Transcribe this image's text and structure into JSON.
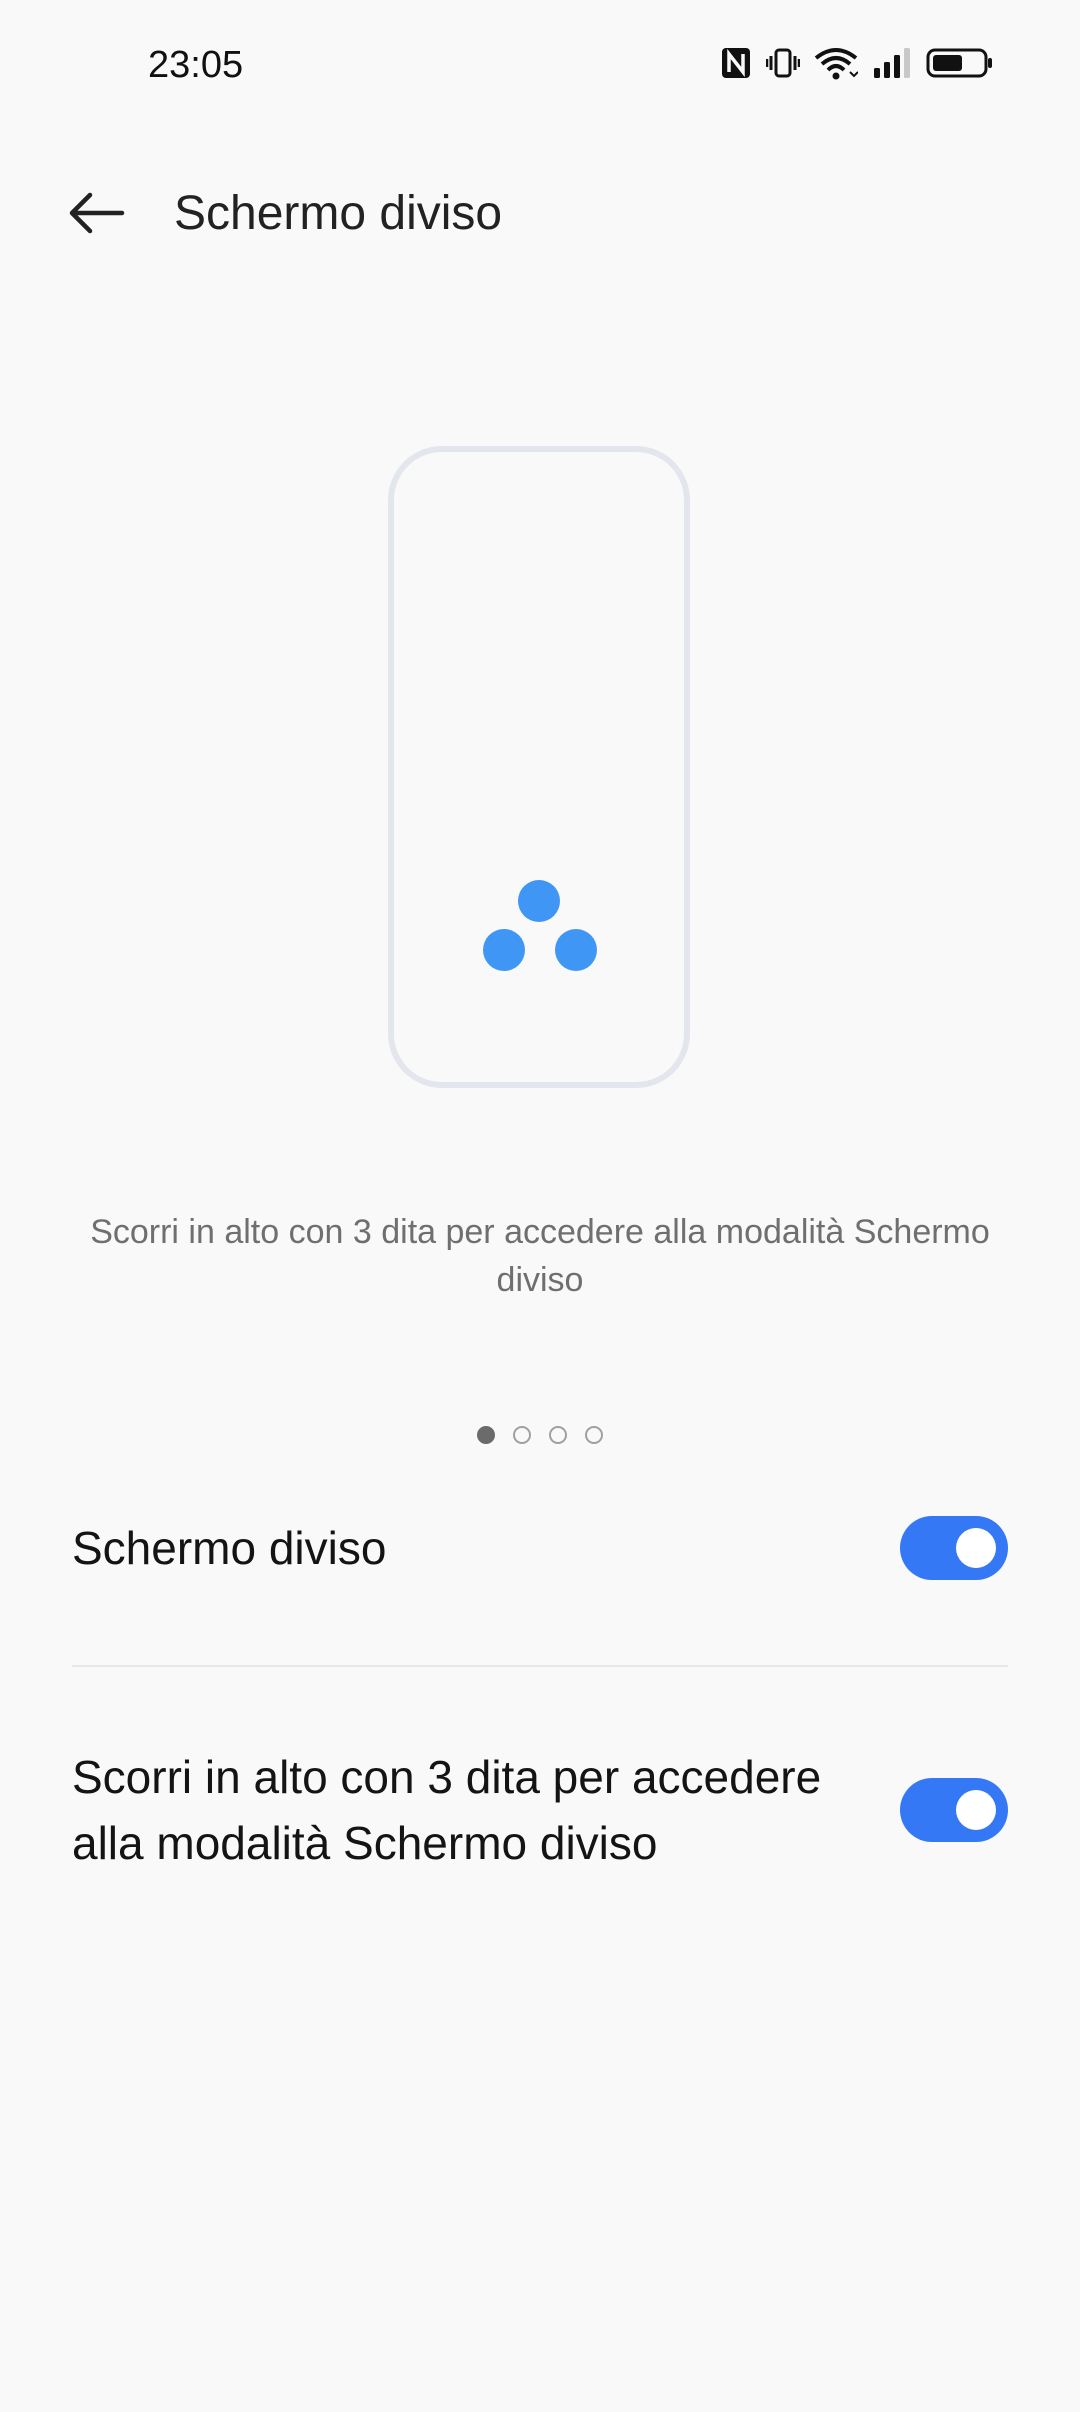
{
  "status_bar": {
    "time": "23:05",
    "icons": [
      "nfc-icon",
      "vibrate-icon",
      "wifi-icon",
      "signal-icon",
      "battery-icon"
    ],
    "battery_level": 0.6
  },
  "app_bar": {
    "back_icon": "arrow-left-icon",
    "title": "Schermo diviso"
  },
  "illustration": {
    "dot_color": "#3f96f5",
    "frame_color": "#e3e6ec"
  },
  "caption": "Scorri in alto con 3 dita per accedere alla modalità Schermo diviso",
  "pager": {
    "count": 4,
    "active_index": 0
  },
  "settings": [
    {
      "label": "Schermo diviso",
      "enabled": true
    },
    {
      "label": "Scorri in alto con 3 dita per accedere alla modalità Schermo diviso",
      "enabled": true
    }
  ],
  "colors": {
    "accent": "#3478f6",
    "background": "#f9f9f9"
  }
}
